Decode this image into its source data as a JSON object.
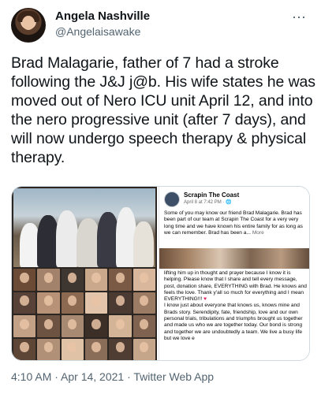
{
  "author": {
    "name": "Angela Nashville",
    "handle": "@Angelaisawake"
  },
  "tweet": {
    "text": "Brad Malagarie, father of 7 had a stroke following the J&J j@b. His wife states he was moved out of Nero ICU unit April 12, and into the nero progressive unit (after 7 days), and will now undergo speech therapy & physical therapy."
  },
  "more_icon": "⋯",
  "media": {
    "fb_post": {
      "page_name": "Scrapin The Coast",
      "date": "April 8 at 7:42 PM · 🌐",
      "text1": "Some of you may know our friend Brad Malagarie. Brad has been part of our team at Scrapin The Coast for a very very long time and we have known his entire family for as long as we can remember. Brad has been a...",
      "more_label": "More",
      "text2a": "lifting him up in thought and prayer because I know it is helping. Please know that I share and tell every message, post, donation share, EVERYTHING with Brad. He knows and feels the love. Thank y'all so much for everything and I mean EVERYTHING!!!",
      "text2b": "I know just about everyone that knows us, knows mine and Brads story. Serendipity, fate, friendship, love and our own personal trials, tribulations and triumphs brought us together and made us who we are together today. Our bond is strong and together we are undoubtedly a team. We live a busy life but we love e"
    },
    "heart_icon": "♥",
    "collage_tile_colors": [
      "#6b4a36",
      "#a3826b",
      "#3e3630",
      "#c9a88b",
      "#7a5a44",
      "#d8b79c",
      "#584237",
      "#b79276",
      "#8c6a52",
      "#e2c4aa",
      "#4a3a31",
      "#9b7b64",
      "#c2a187",
      "#6d5342",
      "#a88a72",
      "#3b2f28",
      "#d4b496",
      "#7f6350",
      "#5e4637",
      "#b09177",
      "#e0c3a6",
      "#8a6d58",
      "#4f3d33",
      "#c6a68b"
    ]
  },
  "timestamp": "4:10 AM · Apr 14, 2021 · Twitter Web App"
}
